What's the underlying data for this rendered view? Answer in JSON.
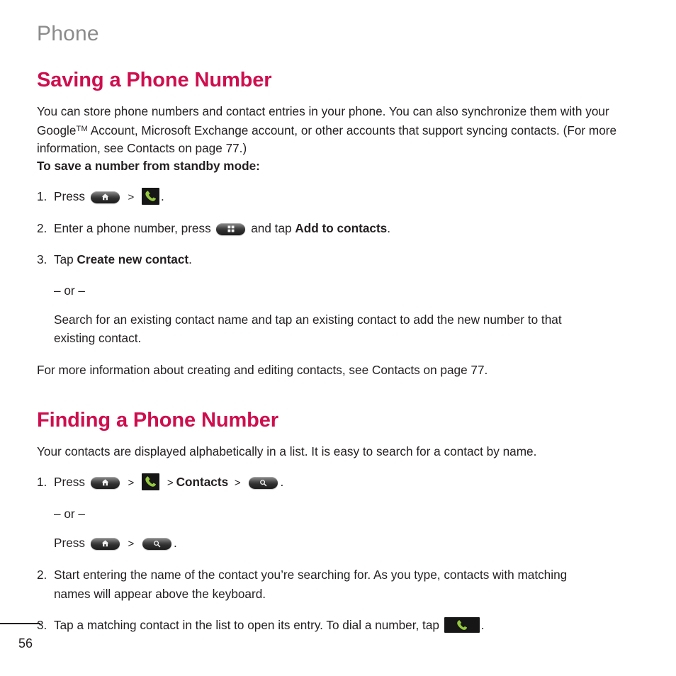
{
  "page": {
    "running_header": "Phone",
    "folio": "56",
    "accent_color": "#ce0e4e",
    "header_color": "#8b8b8b",
    "text_color": "#231f20"
  },
  "sections": [
    {
      "title": "Saving a Phone Number",
      "intro_line1": "You can store phone numbers and contact entries in your phone. You can also synchronize them with your",
      "intro_line2_pre": "Google",
      "intro_line2_sup": "TM",
      "intro_line2_post": " Account, Microsoft Exchange account, or other accounts that support syncing contacts. (For more",
      "intro_line3": "information, see Contacts on page 77.)",
      "subhead": "To save a number from standby mode:",
      "steps": [
        {
          "number": "1.",
          "text_1": "Press",
          "icon_1": "home-key-icon",
          "chevron": ">",
          "icon_2": "phone-dialer-icon",
          "text_2": "."
        },
        {
          "number": "2.",
          "text_1": "Enter a phone number, press",
          "icon_1": "menu-key-icon",
          "text_2": "and tap",
          "bold_1": "Add to contacts",
          "text_3": "."
        },
        {
          "number": "3.",
          "text_1": "Tap",
          "bold_1": "Create new contact",
          "text_2": "."
        }
      ],
      "or_divider": "– or –",
      "alt_text_line1": "Search for an existing contact name and tap an existing contact to add the new number to that",
      "alt_text_line2": "existing contact.",
      "closing": "For more information about creating and editing contacts, see Contacts on page 77."
    },
    {
      "title": "Finding a Phone Number",
      "intro_line1": "Your contacts are displayed alphabetically in a list. It is easy to search for a contact by name.",
      "steps": [
        {
          "number": "1.",
          "text_1": "Press",
          "icon_1": "home-key-icon",
          "chevron_1": ">",
          "icon_2": "phone-dialer-icon",
          "chevron_2": ">",
          "bold_1": "Contacts",
          "chevron_3": ">",
          "icon_3": "search-key-icon",
          "text_2": "."
        },
        {
          "number": "2.",
          "text_1": "Start entering the name of the contact you’re searching for. As you type, contacts with matching",
          "text_2": "names will appear above the keyboard."
        },
        {
          "number": "3.",
          "text_1": "Tap a matching contact in the list to open its entry. To dial a number, tap",
          "icon_1": "phone-dial-wide-icon",
          "text_2": "."
        }
      ],
      "or_divider": "– or –",
      "press_line": {
        "text_1": "Press",
        "icon_1": "home-key-icon",
        "chevron": ">",
        "icon_2": "search-key-icon",
        "text_2": "."
      }
    }
  ]
}
